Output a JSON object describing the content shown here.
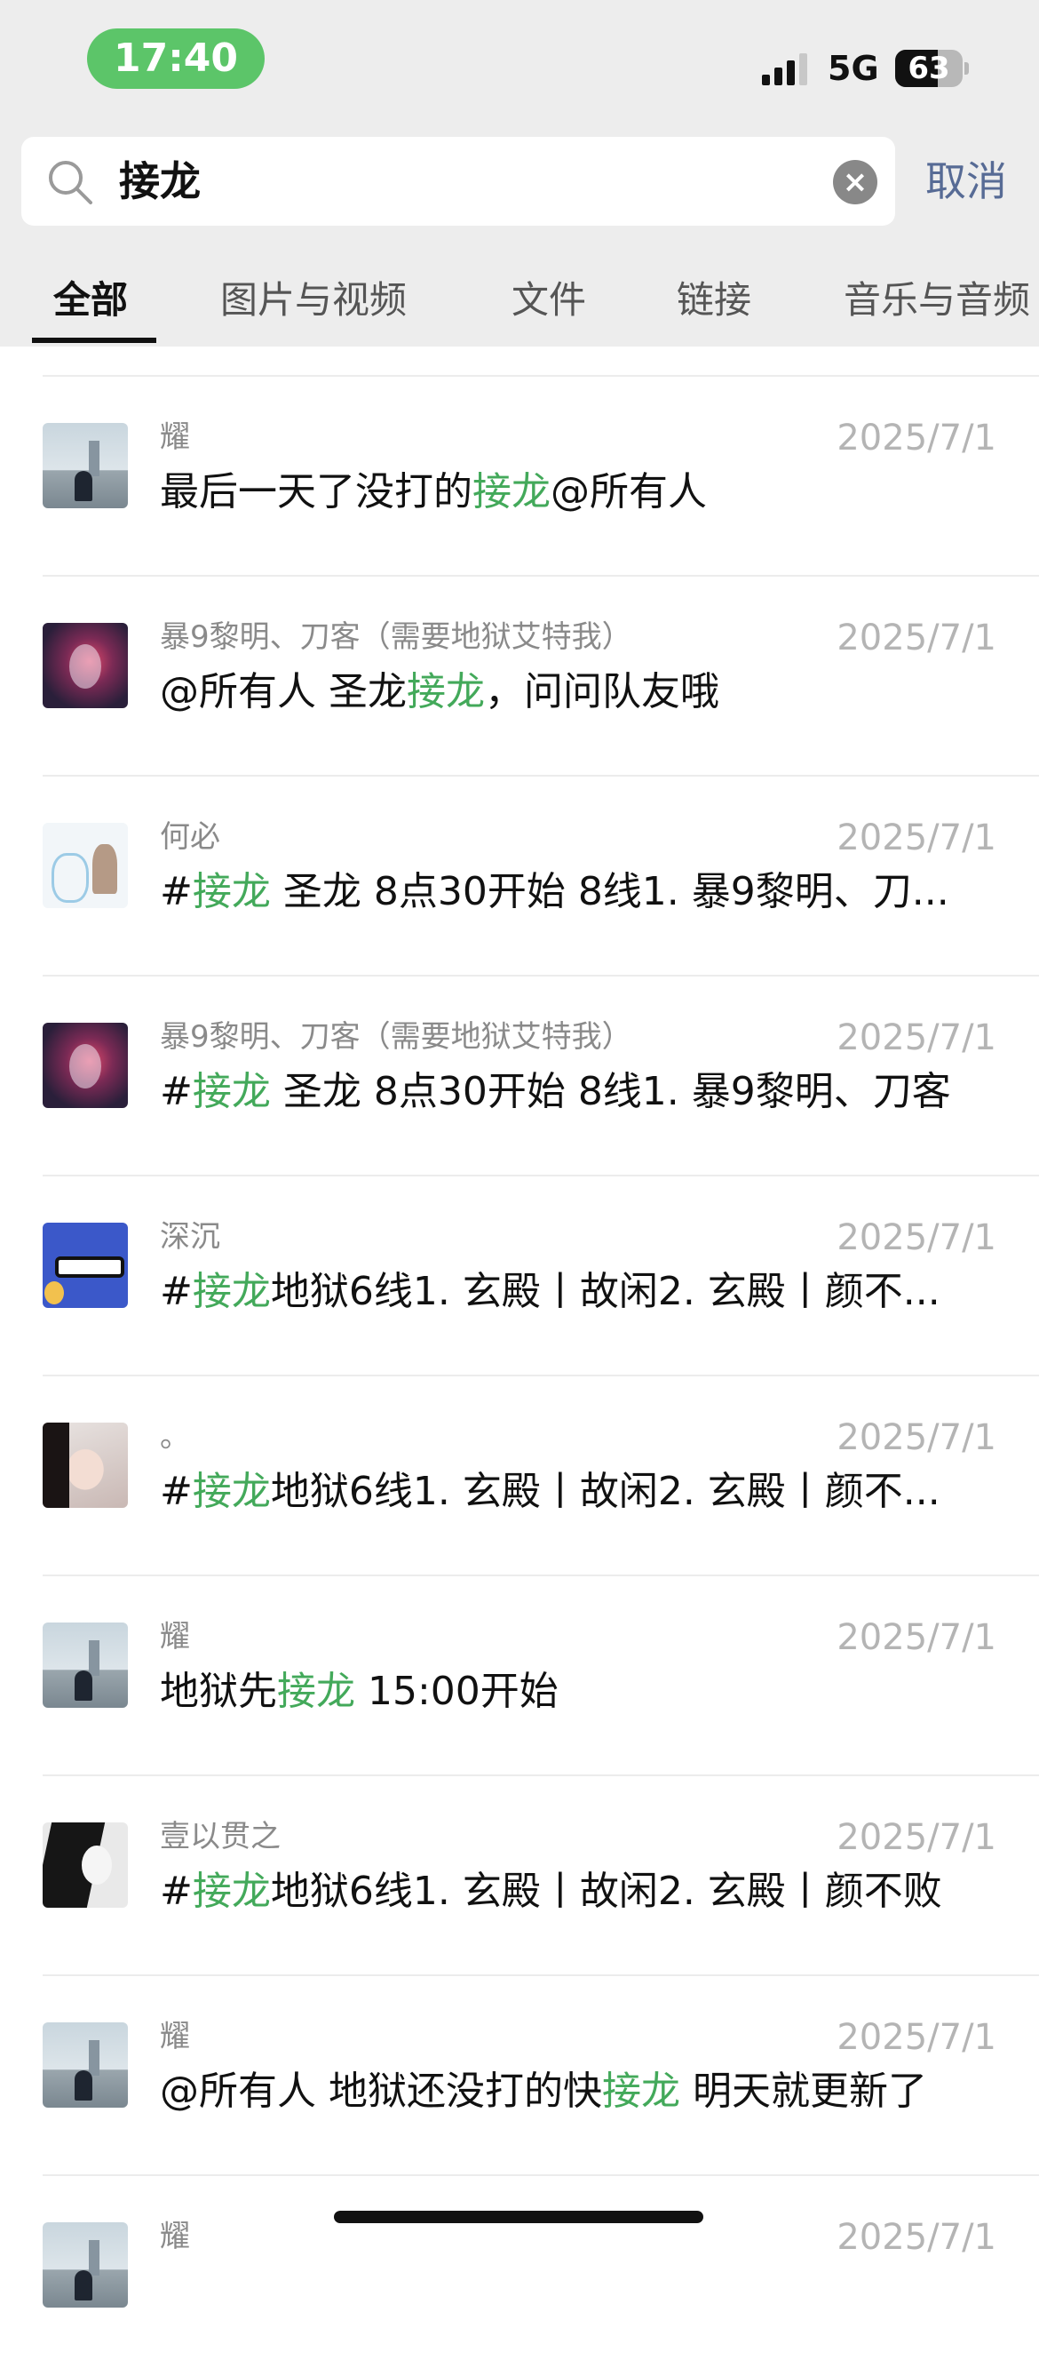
{
  "status_bar": {
    "time": "17:40",
    "network": "5G",
    "battery": "63",
    "battery_level": 0.63,
    "time_pill_color": "#5cc569"
  },
  "search": {
    "query": "接龙",
    "cancel_label": "取消",
    "icon": "search-icon",
    "clear_icon": "clear-icon"
  },
  "tabs": [
    {
      "label": "全部",
      "active": true
    },
    {
      "label": "图片与视频",
      "active": false
    },
    {
      "label": "文件",
      "active": false
    },
    {
      "label": "链接",
      "active": false
    },
    {
      "label": "音乐与音频",
      "active": false
    }
  ],
  "colors": {
    "highlight": "#43a95a",
    "cancel": "#576b95",
    "date": "#b4b4b4",
    "sender": "#8a8a8a"
  },
  "results": [
    {
      "sender": "耀",
      "date": "2025/7/1",
      "avatar": "city",
      "msg": [
        "最后一天了没打的",
        "接龙",
        "@所有人"
      ]
    },
    {
      "sender": "暴9黎明、刀客（需要地狱艾特我）",
      "date": "2025/7/1",
      "avatar": "dark",
      "msg": [
        "@所有人 圣龙",
        "接龙",
        "，问问队友哦"
      ]
    },
    {
      "sender": "何必",
      "date": "2025/7/1",
      "avatar": "sketch",
      "msg": [
        "#",
        "接龙",
        " 圣龙 8点30开始 8线1. 暴9黎明、刀..."
      ]
    },
    {
      "sender": "暴9黎明、刀客（需要地狱艾特我）",
      "date": "2025/7/1",
      "avatar": "dark",
      "msg": [
        "#",
        "接龙",
        " 圣龙 8点30开始 8线1. 暴9黎明、刀客"
      ]
    },
    {
      "sender": "深沉",
      "date": "2025/7/1",
      "avatar": "anime",
      "msg": [
        "#",
        "接龙",
        "地狱6线1. 玄殿丨故闲2. 玄殿丨颜不..."
      ]
    },
    {
      "sender": "。",
      "date": "2025/7/1",
      "avatar": "girl",
      "msg": [
        "#",
        "接龙",
        "地狱6线1. 玄殿丨故闲2. 玄殿丨颜不..."
      ]
    },
    {
      "sender": "耀",
      "date": "2025/7/1",
      "avatar": "city",
      "msg": [
        "地狱先",
        "接龙",
        " 15:00开始"
      ]
    },
    {
      "sender": "壹以贯之",
      "date": "2025/7/1",
      "avatar": "ink",
      "msg": [
        "#",
        "接龙",
        "地狱6线1. 玄殿丨故闲2. 玄殿丨颜不败"
      ]
    },
    {
      "sender": "耀",
      "date": "2025/7/1",
      "avatar": "city",
      "msg": [
        "@所有人 地狱还没打的快",
        "接龙",
        " 明天就更新了"
      ]
    },
    {
      "sender": "耀",
      "date": "2025/7/1",
      "avatar": "city",
      "msg": [
        "",
        "",
        ""
      ]
    }
  ]
}
